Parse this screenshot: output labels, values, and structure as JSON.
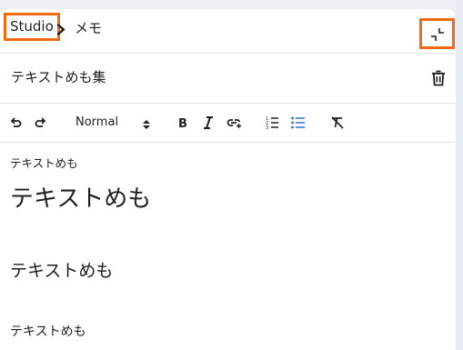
{
  "breadcrumb": {
    "root": "Studio",
    "current": "メモ"
  },
  "document": {
    "title": "テキストめも集"
  },
  "toolbar": {
    "block_style": "Normal",
    "icons": [
      "undo-icon",
      "redo-icon",
      "bold-icon",
      "italic-icon",
      "link-icon",
      "ordered-list-icon",
      "bullet-list-icon",
      "clear-format-icon"
    ],
    "active_color": "#2b6fd6"
  },
  "content": {
    "paragraph_small": "テキストめも",
    "heading1": "テキストめも",
    "heading2": "テキストめも",
    "paragraph": "テキストめも"
  },
  "colors": {
    "highlight": "#f26a10",
    "background": "#eef0f6"
  }
}
